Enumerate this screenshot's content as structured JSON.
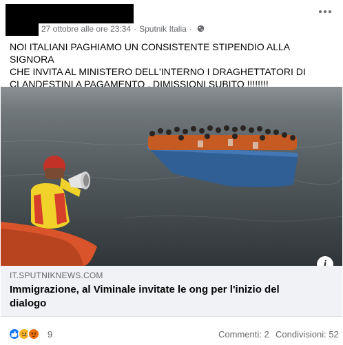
{
  "post": {
    "timestamp": "27 ottobre alle ore 23:34",
    "separator": "·",
    "page_name": "Sputnik Italia",
    "privacy_icon": "globe-icon",
    "more_icon": "more-icon",
    "text": "NOI ITALIANI PAGHIAMO UN CONSISTENTE STIPENDIO ALLA SIGNORA\nCHE INVITA AL MINISTERO DELL'INTERNO I DRAGHETTATORI DI\nCLANDESTINI A PAGAMENTO . DIMISSIONI SUBITO !!!!!!!!"
  },
  "link": {
    "domain": "IT.SPUTNIKNEWS.COM",
    "title": "Immigrazione, al Viminale invitate le ong per l'inizio del dialogo",
    "info_label": "i"
  },
  "footer": {
    "reactions": [
      "like-icon",
      "sad-icon",
      "angry-icon"
    ],
    "reaction_count": "9",
    "comments": "Commenti: 2",
    "shares": "Condivisioni: 52"
  },
  "colors": {
    "meta_text": "#65676b",
    "link_background": "#f0f2f5",
    "like": "#1877f2",
    "sad": "#f7b125",
    "angry": "#e9710f"
  }
}
